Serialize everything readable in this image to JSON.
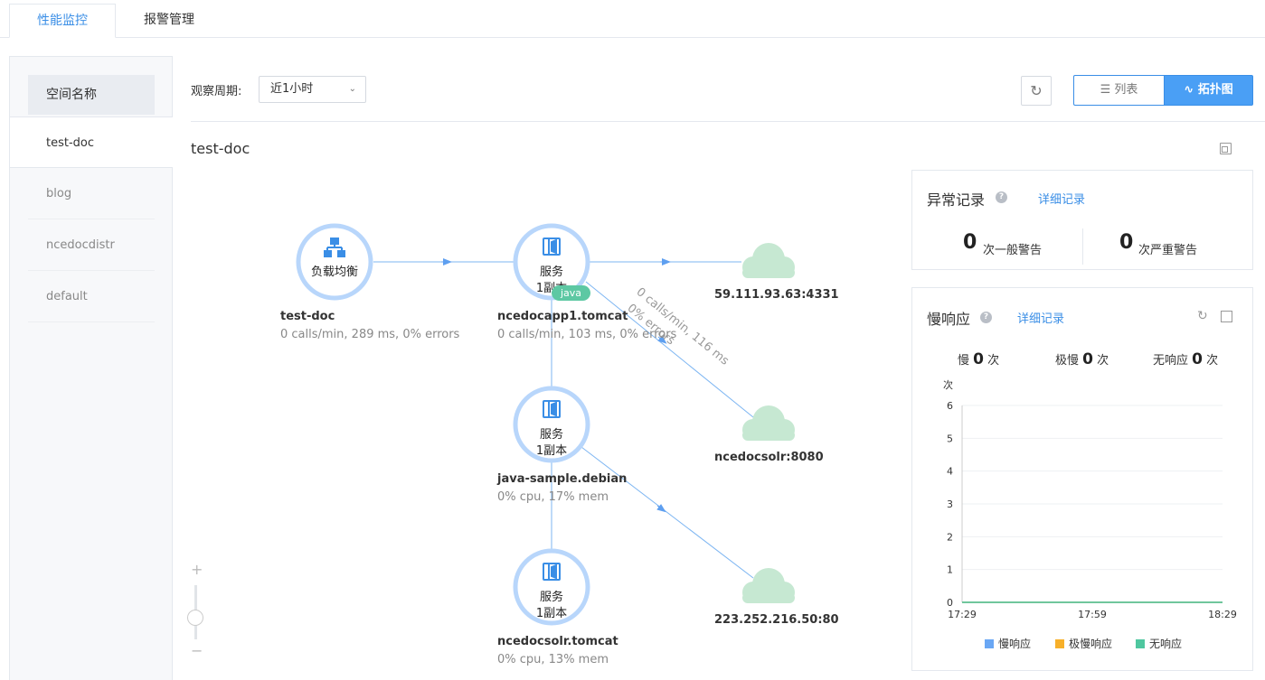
{
  "tabs": [
    {
      "label": "性能监控",
      "active": true
    },
    {
      "label": "报警管理",
      "active": false
    }
  ],
  "sidebar": {
    "header": "空间名称",
    "items": [
      {
        "label": "test-doc",
        "active": true
      },
      {
        "label": "blog",
        "active": false
      },
      {
        "label": "ncedocdistr",
        "active": false
      },
      {
        "label": "default",
        "active": false
      }
    ]
  },
  "toolbar": {
    "period_label": "观察周期:",
    "period_value": "近1小时",
    "view_list_label": "列表",
    "view_topo_label": "拓扑图"
  },
  "space_title": "test-doc",
  "topology": {
    "nodes": [
      {
        "id": "lb",
        "icon": "load-balancer-icon",
        "label": "负载均衡",
        "sub": "",
        "title": "test-doc",
        "stat": "0 calls/min, 289 ms, 0% errors"
      },
      {
        "id": "svc1",
        "icon": "service-icon",
        "label": "服务",
        "sub": "1副本",
        "badge": "java",
        "title": "ncedocapp1.tomcat",
        "stat": "0 calls/min, 103 ms, 0% errors"
      },
      {
        "id": "svc2",
        "icon": "service-icon",
        "label": "服务",
        "sub": "1副本",
        "title": "java-sample.debian",
        "stat": "0% cpu, 17% mem"
      },
      {
        "id": "svc3",
        "icon": "service-icon",
        "label": "服务",
        "sub": "1副本",
        "title": "ncedocsolr.tomcat",
        "stat": "0% cpu, 13% mem"
      }
    ],
    "externals": [
      {
        "id": "ext1",
        "label": "59.111.93.63:4331"
      },
      {
        "id": "ext2",
        "label": "ncedocsolr:8080"
      },
      {
        "id": "ext3",
        "label": "223.252.216.50:80"
      }
    ],
    "edge_labels": {
      "line1": "0 calls/min, 116 ms",
      "line2": "0% errors"
    }
  },
  "zoom": {
    "plus": "+",
    "minus": "−"
  },
  "alerts": {
    "title": "异常记录",
    "detail_link": "详细记录",
    "general_count": "0",
    "general_label": "次一般警告",
    "severe_count": "0",
    "severe_label": "次严重警告"
  },
  "slow": {
    "title": "慢响应",
    "detail_link": "详细记录",
    "slow_label": "慢",
    "slow_count": "0",
    "very_slow_label": "极慢",
    "very_slow_count": "0",
    "no_resp_label": "无响应",
    "no_resp_count": "0",
    "unit": "次"
  },
  "colors": {
    "accent": "#3a8ee6",
    "node_ring": "#b8d6fb",
    "cloud": "#c6e8d2",
    "java_badge": "#5dc8a3",
    "edge": "#7eb6f2"
  },
  "chart_data": {
    "type": "line",
    "ylabel": "次",
    "ylim": [
      0,
      6
    ],
    "yticks": [
      "0",
      "1",
      "2",
      "3",
      "4",
      "5",
      "6"
    ],
    "xticks": [
      "17:29",
      "17:59",
      "18:29"
    ],
    "series": [
      {
        "name": "慢响应",
        "color": "#6aa7f4",
        "values": [
          0,
          0,
          0
        ]
      },
      {
        "name": "极慢响应",
        "color": "#f7b02a",
        "values": [
          0,
          0,
          0
        ]
      },
      {
        "name": "无响应",
        "color": "#4fc79f",
        "values": [
          0,
          0,
          0
        ]
      }
    ],
    "legend": "bottom",
    "grid": true
  }
}
